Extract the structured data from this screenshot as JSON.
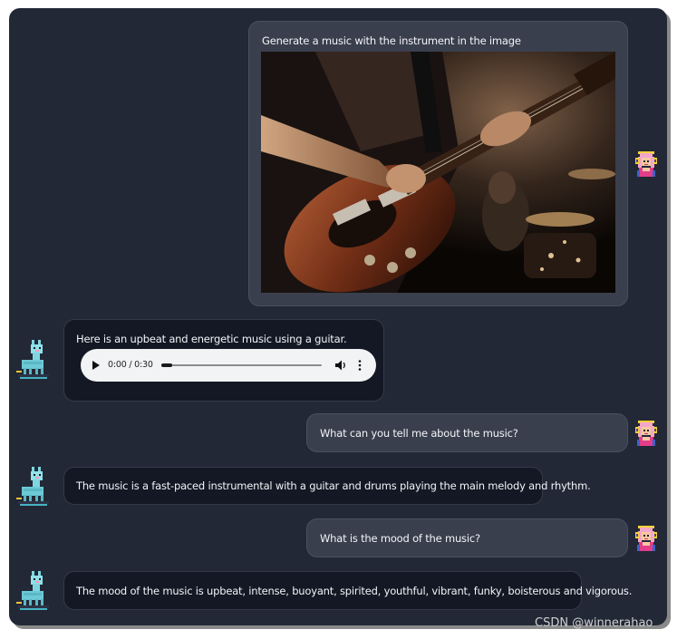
{
  "colors": {
    "panel_bg": "#222836",
    "user_bubble": "#3a3f4d",
    "bot_bubble": "#141824",
    "text": "#f2f4f8",
    "audio_player_bg": "#f1f3f4"
  },
  "messages": [
    {
      "role": "user",
      "text": "Generate a music with the instrument in the image",
      "attachment": "image",
      "image_icon": "electric-guitar-photo",
      "avatar_icon": "pixel-art-girl-with-headphones-icon"
    },
    {
      "role": "assistant",
      "text": "Here is an upbeat and energetic music using a guitar.",
      "avatar_icon": "pixel-art-llama-icon",
      "audio": {
        "time_display": "0:00 / 0:30",
        "progress": 0.07,
        "icons": [
          "play-icon",
          "volume-icon",
          "more-options-icon"
        ]
      }
    },
    {
      "role": "user",
      "text": "What can you tell me about the music?",
      "avatar_icon": "pixel-art-girl-with-headphones-icon"
    },
    {
      "role": "assistant",
      "text": "The music is a fast-paced instrumental with a guitar and drums playing the main melody and rhythm.",
      "avatar_icon": "pixel-art-llama-icon"
    },
    {
      "role": "user",
      "text": "What is the mood of the music?",
      "avatar_icon": "pixel-art-girl-with-headphones-icon"
    },
    {
      "role": "assistant",
      "text": "The mood of the music is upbeat, intense, buoyant, spirited, youthful, vibrant, funky, boisterous and vigorous.",
      "avatar_icon": "pixel-art-llama-icon"
    }
  ],
  "watermark": "CSDN @winnerahao"
}
